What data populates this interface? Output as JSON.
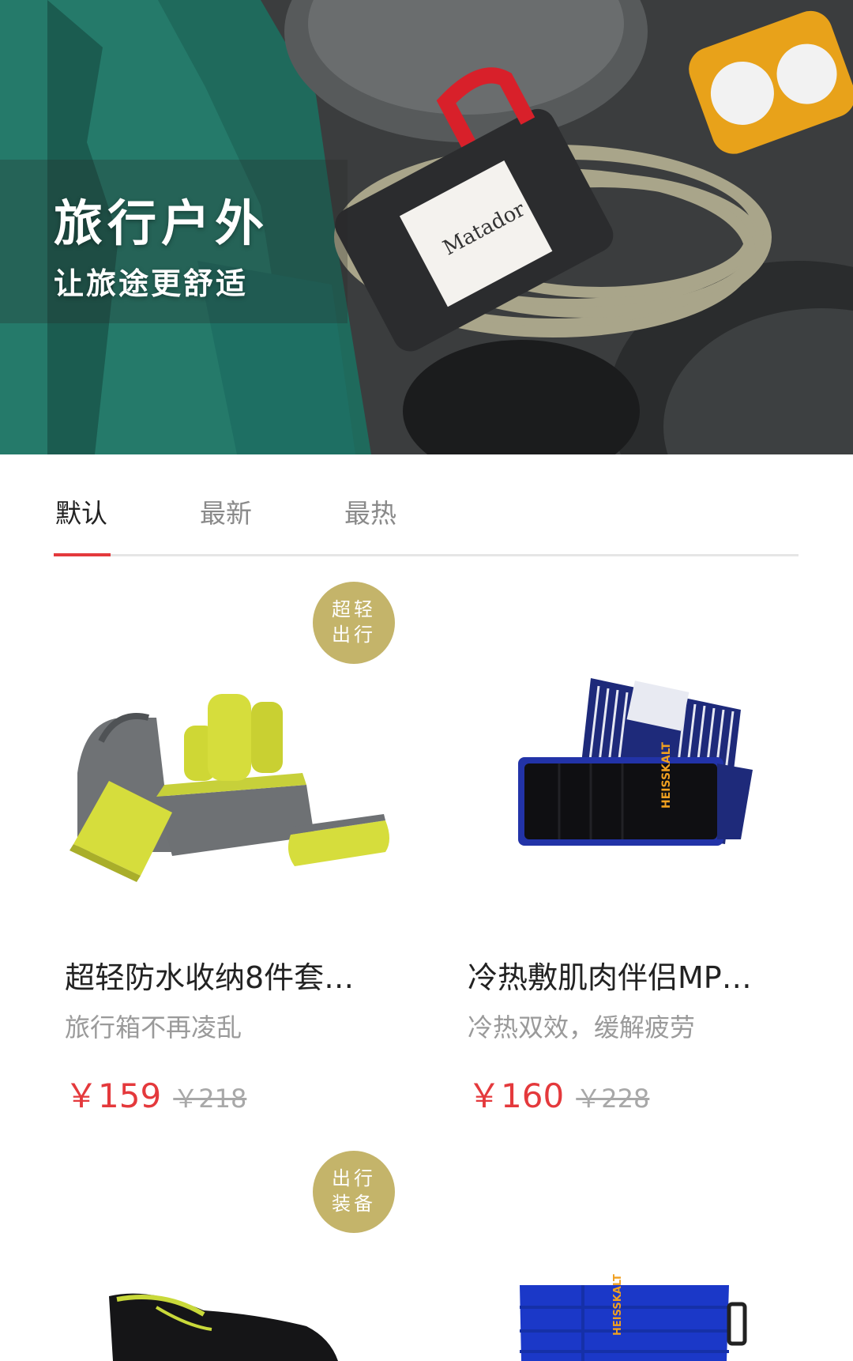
{
  "hero": {
    "title": "旅行户外",
    "subtitle": "让旅途更舒适",
    "image": "outdoor-gear-flatlay-photo",
    "label_text": "Matador"
  },
  "tabs": [
    {
      "label": "默认",
      "active": true
    },
    {
      "label": "最新",
      "active": false
    },
    {
      "label": "最热",
      "active": false
    }
  ],
  "products": [
    {
      "badge": [
        "超轻",
        "出行"
      ],
      "name": "超轻防水收纳8件套…",
      "subtitle": "旅行箱不再凌乱",
      "price": "￥159",
      "original_price": "￥218",
      "image": "yellow-packing-cubes-set"
    },
    {
      "badge": [],
      "name": "冷热敷肌肉伴侣MP…",
      "subtitle": "冷热双效，缓解疲劳",
      "price": "￥160",
      "original_price": "￥228",
      "image": "hot-cold-muscle-wrap",
      "brand_text": "HEISSKALT"
    },
    {
      "badge": [
        "出行",
        "装备"
      ],
      "name": "",
      "subtitle": "",
      "price": "",
      "original_price": "",
      "image": "black-aqua-shoe"
    },
    {
      "badge": [],
      "name": "",
      "subtitle": "",
      "price": "",
      "original_price": "",
      "image": "blue-heiss-kalt-wrap",
      "brand_text": "HEISSKALT"
    }
  ],
  "colors": {
    "accent": "#e4393c",
    "badge": "#c4b46a",
    "text_primary": "#222222",
    "text_secondary": "#9a9a9a"
  }
}
